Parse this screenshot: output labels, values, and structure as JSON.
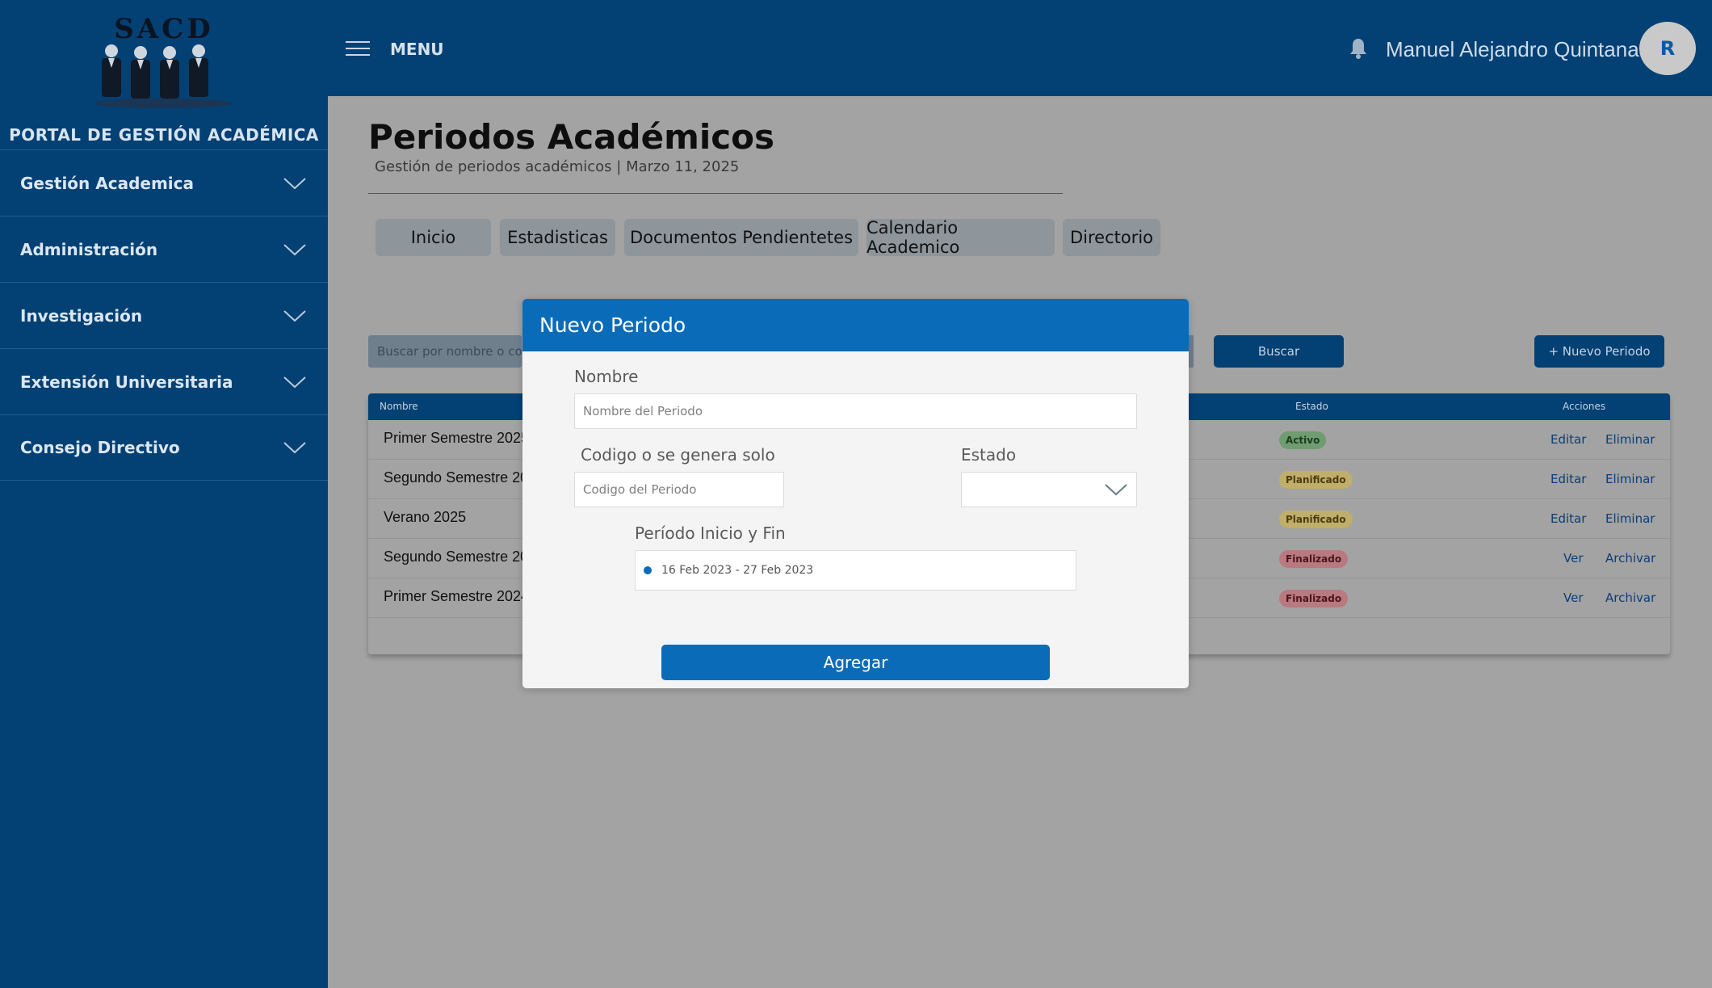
{
  "app": {
    "logo_text": "SACD",
    "portal_title": "PORTAL DE GESTIÓN ACADÉMICA"
  },
  "sidebar": {
    "items": [
      {
        "label": "Gestión Academica"
      },
      {
        "label": "Administración"
      },
      {
        "label": "Investigación"
      },
      {
        "label": "Extensión Universitaria"
      },
      {
        "label": "Consejo Directivo"
      }
    ]
  },
  "topbar": {
    "menu_label": "MENU",
    "user_name": "Manuel Alejandro Quintana",
    "avatar_initial": "R"
  },
  "page": {
    "title": "Periodos Académicos",
    "subtitle": "Gestión de periodos académicos | Marzo 11, 2025"
  },
  "tabs": [
    {
      "label": "Inicio"
    },
    {
      "label": "Estadisticas"
    },
    {
      "label": "Documentos Pendientetes"
    },
    {
      "label": "Calendario Academico"
    },
    {
      "label": "Directorio"
    }
  ],
  "search": {
    "placeholder": "Buscar por nombre o codigo",
    "button_label": "Buscar",
    "new_button_label": "+ Nuevo Periodo"
  },
  "table": {
    "headers": {
      "name": "Nombre",
      "status": "Estado",
      "actions": "Acciones"
    },
    "rows": [
      {
        "name": "Primer Semestre 2025",
        "status": "Activo",
        "action1": "Editar",
        "action2": "Eliminar"
      },
      {
        "name": "Segundo Semestre 2025",
        "status": "Planificado",
        "action1": "Editar",
        "action2": "Eliminar"
      },
      {
        "name": "Verano 2025",
        "status": "Planificado",
        "action1": "Editar",
        "action2": "Eliminar"
      },
      {
        "name": "Segundo Semestre 2024",
        "status": "Finalizado",
        "action1": "Ver",
        "action2": "Archivar"
      },
      {
        "name": "Primer Semestre 2024",
        "status": "Finalizado",
        "action1": "Ver",
        "action2": "Archivar"
      }
    ]
  },
  "modal": {
    "title": "Nuevo Periodo",
    "name_label": "Nombre",
    "name_placeholder": "Nombre del Periodo",
    "code_label": "Codigo o se genera solo",
    "code_placeholder": "Codigo del Periodo",
    "status_label": "Estado",
    "status_value": "",
    "period_label": "Período Inicio y Fin",
    "period_value": "16 Feb 2023 - 27 Feb 2023",
    "submit_label": "Agregar"
  },
  "colors": {
    "primary": "#034074",
    "modal_header": "#0a6cb9",
    "badge_activo_bg": "#6f9c70",
    "badge_planificado_bg": "#c0ae6a",
    "badge_finalizado_bg": "#b87a80"
  },
  "icons": [
    "hamburger-menu-icon",
    "bell-icon",
    "chevron-down-icon",
    "logo-people-icon"
  ]
}
